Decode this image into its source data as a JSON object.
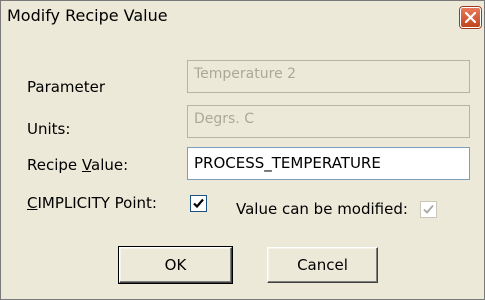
{
  "window": {
    "title": "Modify Recipe Value"
  },
  "form": {
    "parameter_label": "Parameter",
    "parameter_value": "Temperature 2",
    "units_label": "Units:",
    "units_value": "Degrs. C",
    "recipe_value_label_pre": "Recipe ",
    "recipe_value_label_key": "V",
    "recipe_value_label_post": "alue:",
    "recipe_value": "PROCESS_TEMPERATURE",
    "cimplicity_label_key": "C",
    "cimplicity_label_post": "IMPLICITY Point:",
    "cimplicity_checked": true,
    "modifiable_label": "Value can be modified:",
    "modifiable_checked": true
  },
  "buttons": {
    "ok_label": "OK",
    "cancel_label": "Cancel"
  },
  "icons": {
    "close": "close-icon",
    "check": "checkmark-icon"
  }
}
